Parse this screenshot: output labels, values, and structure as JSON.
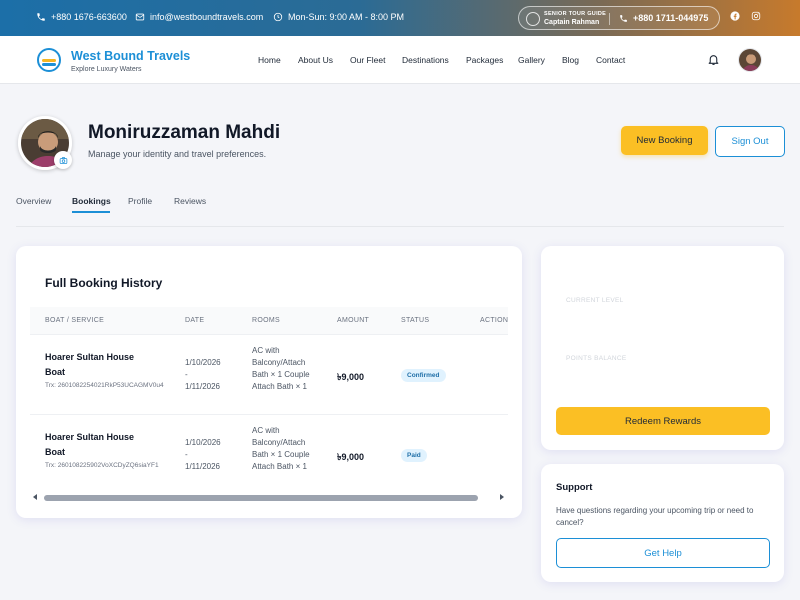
{
  "topbar": {
    "phone": "+880 1676-663600",
    "email": "info@westboundtravels.com",
    "hours": "Mon-Sun: 9:00 AM - 8:00 PM",
    "guide_label": "SENIOR TOUR GUIDE",
    "guide_name": "Captain Rahman",
    "guide_phone": "+880 1711-044975"
  },
  "brand": {
    "name": "West Bound Travels",
    "tagline": "Explore Luxury Waters"
  },
  "nav": {
    "items": [
      "Home",
      "About Us",
      "Our Fleet",
      "Destinations",
      "Packages",
      "Gallery",
      "Blog",
      "Contact"
    ]
  },
  "profile": {
    "name": "Moniruzzaman Mahdi",
    "subtitle": "Manage your identity and travel preferences.",
    "new_booking": "New Booking",
    "sign_out": "Sign Out"
  },
  "tabs": [
    "Overview",
    "Bookings",
    "Profile",
    "Reviews"
  ],
  "bookings": {
    "title": "Full Booking History",
    "columns": [
      "BOAT / SERVICE",
      "DATE",
      "ROOMS",
      "AMOUNT",
      "STATUS",
      "ACTION"
    ],
    "rows": [
      {
        "boat": "Hoarer Sultan House Boat",
        "trx": "Trx: 2601082254021RkP53UCAGMV0u4",
        "date_from": "1/10/2026",
        "date_sep": "-",
        "date_to": "1/11/2026",
        "rooms": "AC with Balcony/Attach Bath × 1 Couple Attach Bath × 1",
        "amount": "৳9,000",
        "status": "Confirmed"
      },
      {
        "boat": "Hoarer Sultan House Boat",
        "trx": "Trx: 2601082259​02VoXCDyZQ6siaYF1",
        "date_from": "1/10/2026",
        "date_sep": "-",
        "date_to": "1/11/2026",
        "rooms": "AC with Balcony/Attach Bath × 1 Couple Attach Bath × 1",
        "amount": "৳9,000",
        "status": "Paid"
      }
    ]
  },
  "rewards": {
    "current_level_label": "CURRENT LEVEL",
    "points_balance_label": "POINTS BALANCE",
    "redeem": "Redeem Rewards"
  },
  "support": {
    "title": "Support",
    "text": "Have questions regarding your upcoming trip or need to cancel?",
    "button": "Get Help"
  },
  "colors": {
    "accent_blue": "#1c8fd6",
    "accent_yellow": "#fbbf24"
  }
}
